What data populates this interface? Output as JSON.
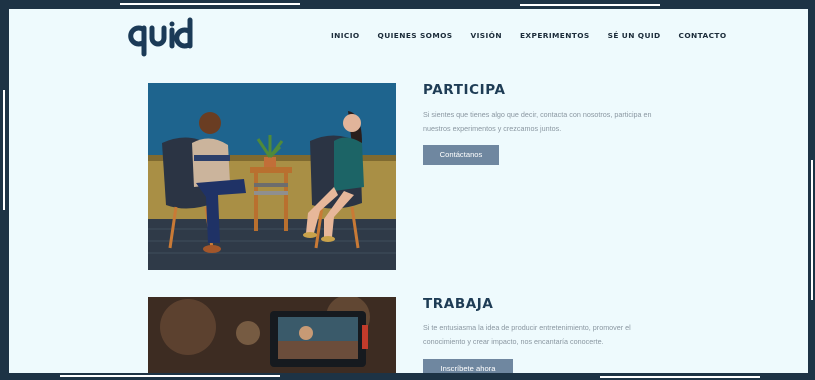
{
  "brand": {
    "logo_text": "quid"
  },
  "nav": {
    "items": [
      "INICIO",
      "QUIENES SOMOS",
      "VISIÓN",
      "EXPERIMENTOS",
      "SÉ UN QUID",
      "CONTACTO"
    ]
  },
  "participa": {
    "title": "PARTICIPA",
    "text_line1": "Si sientes que tienes algo que decir, contacta con nosotros, participa en",
    "text_line2": "nuestros experimentos y crezcamos juntos.",
    "button": "Contáctanos"
  },
  "trabaja": {
    "title": "TRABAJA",
    "text_line1": "Si te entusiasma la idea de producir entretenimiento, promover el",
    "text_line2": "conocimiento y crear impacto, nos encantaría conocerte.",
    "button": "Inscríbete ahora"
  },
  "colors": {
    "background": "#eefafd",
    "heading": "#1e3c55",
    "button": "#6f87a0",
    "frame": "#1d3345"
  }
}
